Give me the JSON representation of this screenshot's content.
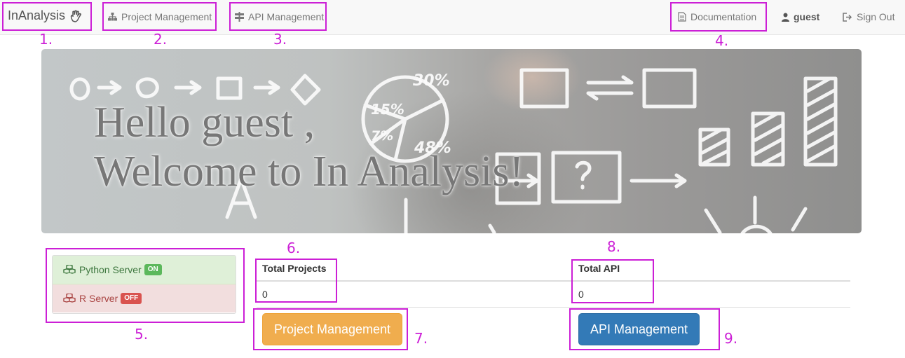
{
  "navbar": {
    "brand": "InAnalysis",
    "brand_icon": "hand-icon",
    "project_management": "Project Management",
    "api_management": "API Management",
    "documentation": "Documentation",
    "user": "guest",
    "sign_out": "Sign Out"
  },
  "annotations": [
    "1.",
    "2.",
    "3.",
    "4.",
    "5.",
    "6.",
    "7.",
    "8.",
    "9."
  ],
  "hero": {
    "line1": "Hello guest ,",
    "line2": "Welcome to In Analysis!",
    "art_labels": [
      "30%",
      "15%",
      "7%",
      "48%"
    ]
  },
  "servers": {
    "python": {
      "label": "Python Server",
      "status": "ON"
    },
    "r": {
      "label": "R Server",
      "status": "OFF"
    }
  },
  "stats": {
    "projects": {
      "header": "Total Projects",
      "value": "0"
    },
    "api": {
      "header": "Total API",
      "value": "0"
    }
  },
  "buttons": {
    "project_management": "Project Management",
    "api_management": "API Management"
  },
  "colors": {
    "annotation": "#cc1fd6",
    "success_bg": "#dff0d8",
    "danger_bg": "#f2dede",
    "warning_button": "#f0ad4e",
    "primary_button": "#337ab7"
  }
}
